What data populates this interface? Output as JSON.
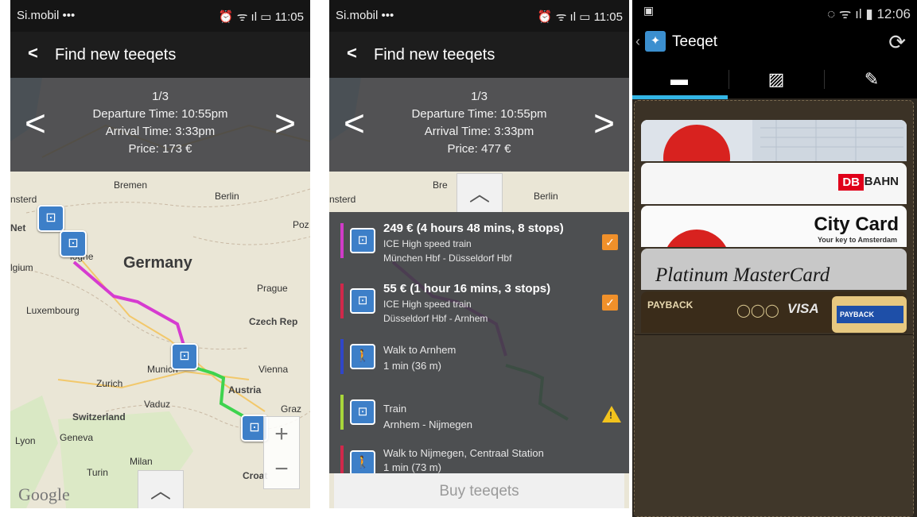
{
  "screen1": {
    "status": {
      "carrier": "Si.mobil ••• ",
      "time": "11:05"
    },
    "header": {
      "title": "Find new teeqets"
    },
    "trip": {
      "index": "1/3",
      "departure": "Departure Time: 10:55pm",
      "arrival": "Arrival Time: 3:33pm",
      "price": "Price: 173 €"
    },
    "map_labels": {
      "bremen": "Bremen",
      "berlin": "Berlin",
      "poz": "Poz",
      "germany": "Germany",
      "belgium": "lgium",
      "luxembourg": "Luxembourg",
      "prague": "Prague",
      "czech": "Czech Rep",
      "munich": "Munich",
      "vienna": "Vienna",
      "zurich": "Zurich",
      "austria": "Austria",
      "vaduz": "Vaduz",
      "switzerland": "Switzerland",
      "graz": "Graz",
      "lyon": "Lyon",
      "geneva": "Geneva",
      "milan": "Milan",
      "turin": "Turin",
      "croat": "Croat",
      "amsterdam": "nsterd",
      "net": "Net",
      "cologne": "logne"
    },
    "zoom": {
      "plus": "+",
      "minus": "−"
    },
    "google": "Google"
  },
  "screen2": {
    "status": {
      "carrier": "Si.mobil ••• ",
      "time": "11:05"
    },
    "header": {
      "title": "Find new teeqets"
    },
    "trip": {
      "index": "1/3",
      "departure": "Departure Time: 10:55pm",
      "arrival": "Arrival Time: 3:33pm",
      "price": "Price: 477 €"
    },
    "segments": [
      {
        "title": "249 € (4 hours 48 mins, 8 stops)",
        "type": "ICE High speed train",
        "route": "München Hbf - Düsseldorf Hbf",
        "color": "#d03bc8",
        "status": "check"
      },
      {
        "title": "55 € (1 hour 16 mins, 3 stops)",
        "type": "ICE High speed train",
        "route": "Düsseldorf Hbf - Arnhem",
        "color": "#d0284a",
        "status": "check"
      },
      {
        "title": "Walk to Arnhem",
        "sub": "1 min (36 m)",
        "color": "#3046c8",
        "status": "none"
      },
      {
        "title": "Train",
        "sub": "Arnhem - Nijmegen",
        "color": "#a8d63a",
        "status": "warn"
      },
      {
        "title": "Walk to Nijmegen, Centraal Station",
        "sub": "1 min (73 m)",
        "color": "#d0284a",
        "status": "none"
      }
    ],
    "buy_label": "Buy teeqets"
  },
  "screen3": {
    "status": {
      "time": "12:06"
    },
    "header": {
      "title": "Teeqet"
    },
    "tabs": [
      "list-icon",
      "map-icon",
      "ticket-icon"
    ],
    "cards": {
      "db": "BAHN",
      "db_logo": "DB",
      "city_card": "City Card",
      "city_tag": "Your key to Amsterdam",
      "platinum": "Platinum MasterCard",
      "payback": "PAYBACK",
      "visa": "VISA",
      "payback2": "PAYBACK"
    }
  }
}
